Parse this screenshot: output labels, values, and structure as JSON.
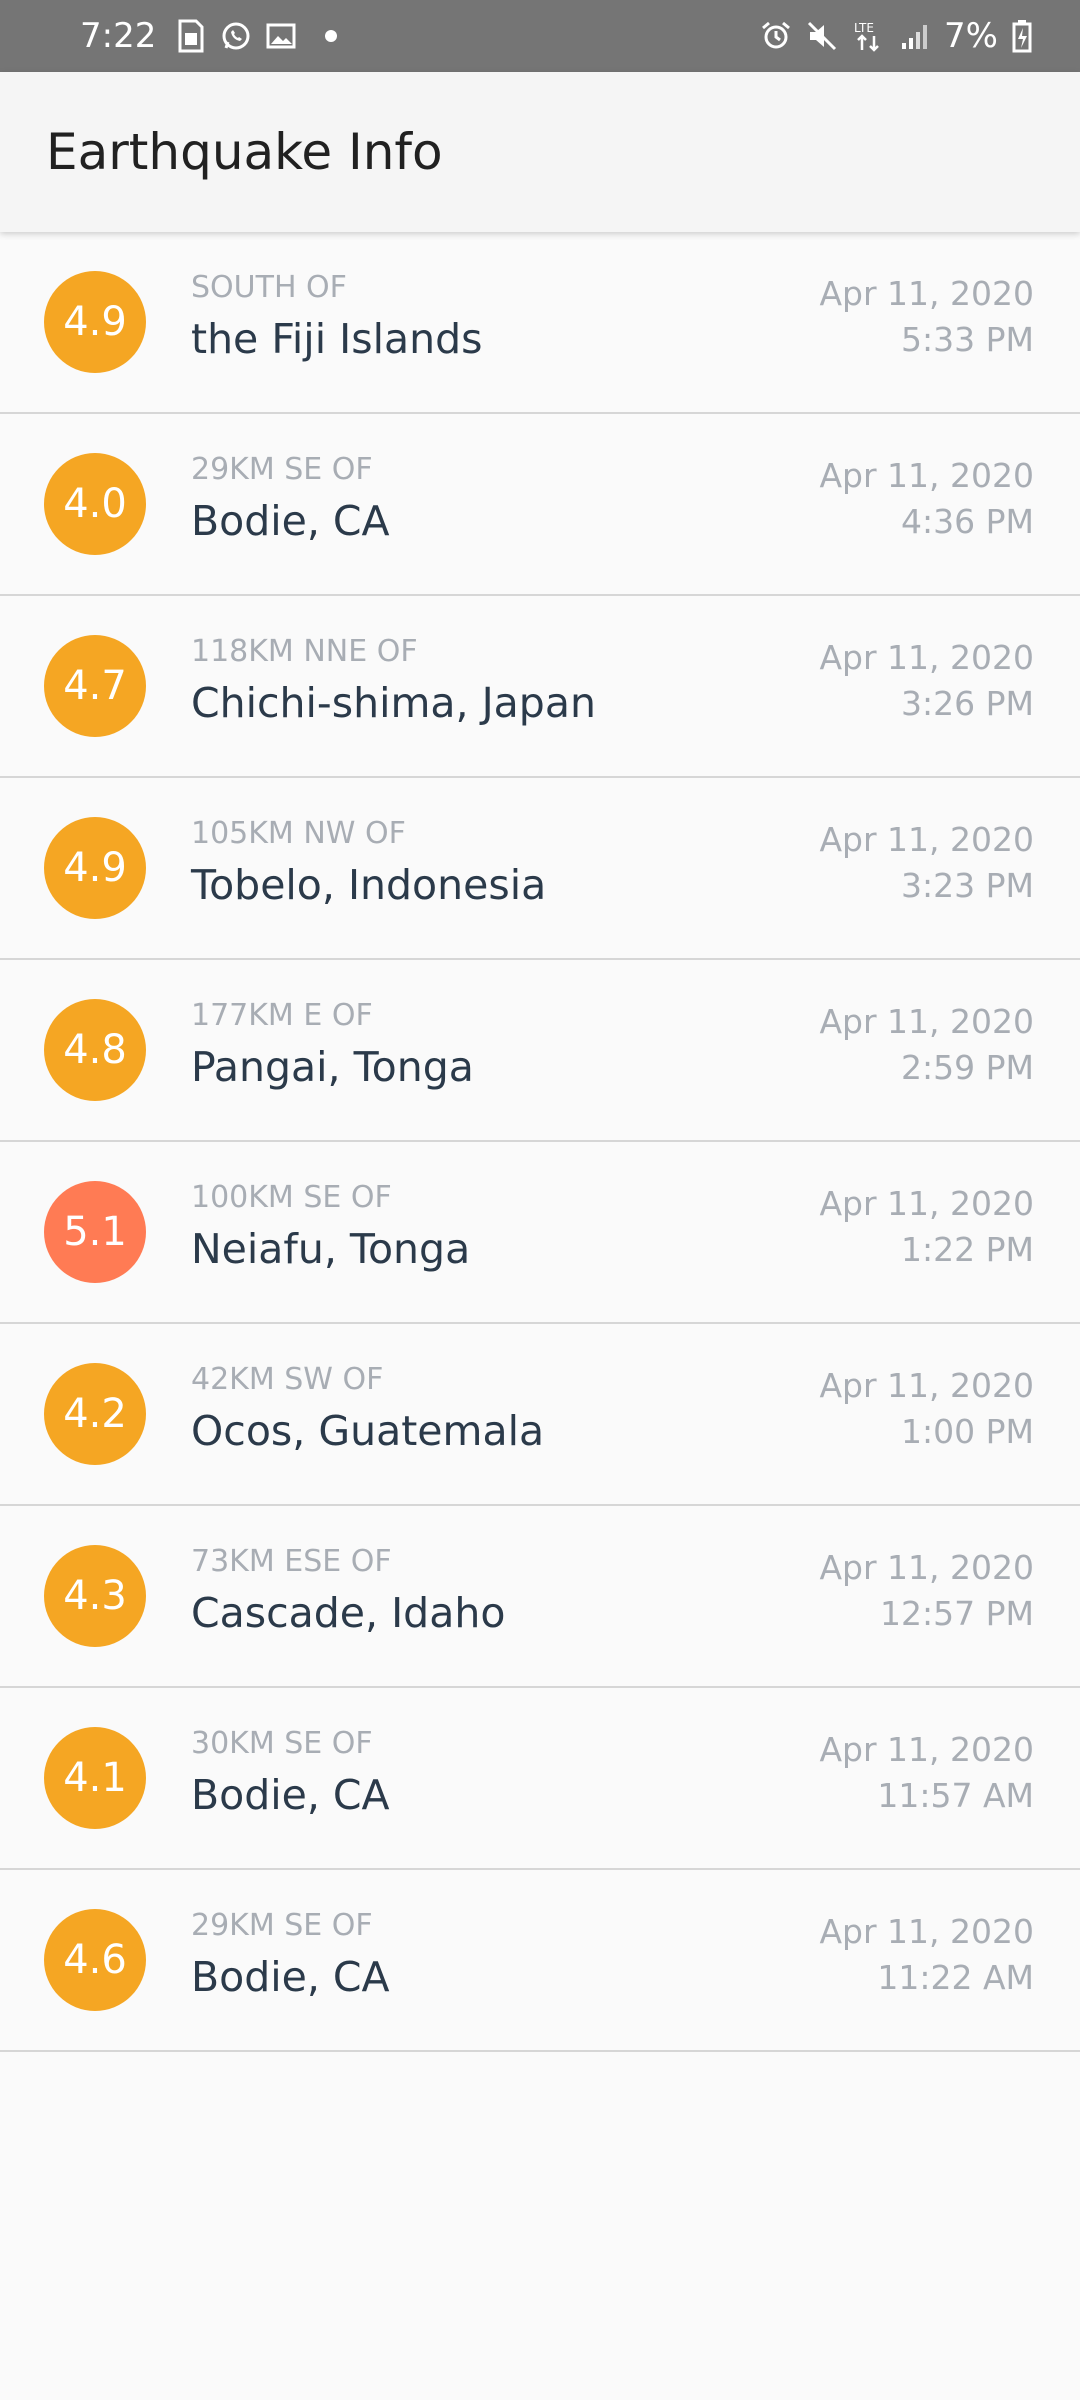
{
  "status_bar": {
    "time": "7:22",
    "battery": "7%",
    "left_icons": [
      "sim-card-icon",
      "whatsapp-icon",
      "image-icon",
      "dot-icon"
    ],
    "right_icons": [
      "alarm-icon",
      "mute-icon",
      "lte-icon",
      "signal-icon",
      "battery-icon"
    ]
  },
  "app_bar": {
    "title": "Earthquake Info"
  },
  "colors": {
    "mag_4_color": "#f5a623",
    "mag_5_color": "#ff7b54",
    "status_bar_bg": "#757575",
    "app_bar_bg": "#f5f5f5",
    "secondary_text": "#a8adb4",
    "primary_text": "#2b3a4a"
  },
  "earthquakes": [
    {
      "magnitude": "4.9",
      "offset": "SOUTH OF",
      "place": "the Fiji Islands",
      "date": "Apr 11, 2020",
      "time": "5:33 PM",
      "color": "#f5a623"
    },
    {
      "magnitude": "4.0",
      "offset": "29KM SE OF",
      "place": "Bodie, CA",
      "date": "Apr 11, 2020",
      "time": "4:36 PM",
      "color": "#f5a623"
    },
    {
      "magnitude": "4.7",
      "offset": "118KM NNE OF",
      "place": "Chichi-shima, Japan",
      "date": "Apr 11, 2020",
      "time": "3:26 PM",
      "color": "#f5a623"
    },
    {
      "magnitude": "4.9",
      "offset": "105KM NW OF",
      "place": "Tobelo, Indonesia",
      "date": "Apr 11, 2020",
      "time": "3:23 PM",
      "color": "#f5a623"
    },
    {
      "magnitude": "4.8",
      "offset": "177KM E OF",
      "place": "Pangai, Tonga",
      "date": "Apr 11, 2020",
      "time": "2:59 PM",
      "color": "#f5a623"
    },
    {
      "magnitude": "5.1",
      "offset": "100KM SE OF",
      "place": "Neiafu, Tonga",
      "date": "Apr 11, 2020",
      "time": "1:22 PM",
      "color": "#ff7b54"
    },
    {
      "magnitude": "4.2",
      "offset": "42KM SW OF",
      "place": "Ocos, Guatemala",
      "date": "Apr 11, 2020",
      "time": "1:00 PM",
      "color": "#f5a623"
    },
    {
      "magnitude": "4.3",
      "offset": "73KM ESE OF",
      "place": "Cascade, Idaho",
      "date": "Apr 11, 2020",
      "time": "12:57 PM",
      "color": "#f5a623"
    },
    {
      "magnitude": "4.1",
      "offset": "30KM SE OF",
      "place": "Bodie, CA",
      "date": "Apr 11, 2020",
      "time": "11:57 AM",
      "color": "#f5a623"
    },
    {
      "magnitude": "4.6",
      "offset": "29KM SE OF",
      "place": "Bodie, CA",
      "date": "Apr 11, 2020",
      "time": "11:22 AM",
      "color": "#f5a623"
    }
  ]
}
